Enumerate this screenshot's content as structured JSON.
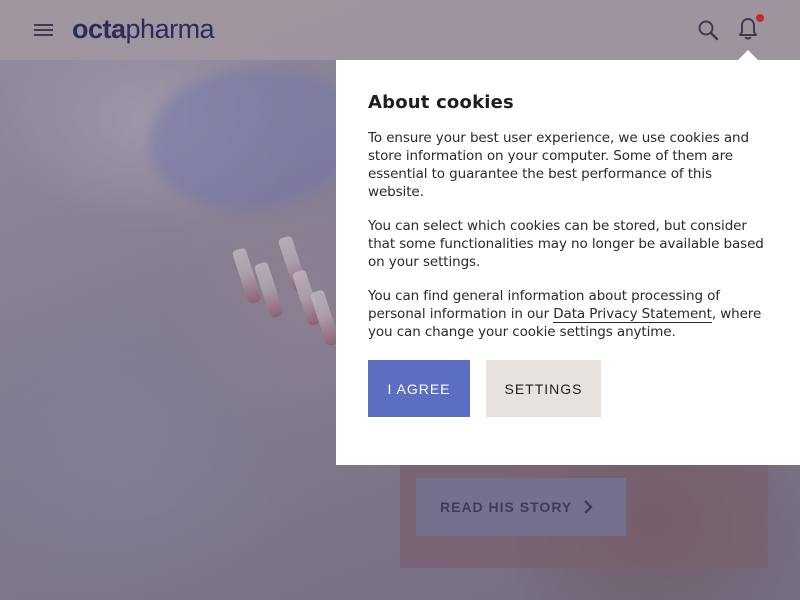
{
  "header": {
    "logo_bold": "octa",
    "logo_light": "pharma",
    "icons": [
      "menu-icon",
      "search-icon",
      "bell-icon"
    ],
    "notification_color": "#c8282e"
  },
  "story": {
    "button_label": "READ HIS STORY"
  },
  "cookie": {
    "title": "About cookies",
    "p1": "To ensure your best user experience, we use cookies and store information on your computer. Some of them are essential to guarantee the best performance of this website.",
    "p2": "You can select which cookies can be stored, but consider that some functionalities may no longer be available based on your settings.",
    "p3_before": "You can find general information about processing of personal information in our ",
    "p3_link": "Data Privacy Statement",
    "p3_after": ", where you can change your cookie settings anytime.",
    "agree_label": "I AGREE",
    "settings_label": "SETTINGS"
  },
  "colors": {
    "brand": "#2c2a5e",
    "agree_button": "#5b6ec1",
    "settings_button": "#e8e2df"
  }
}
